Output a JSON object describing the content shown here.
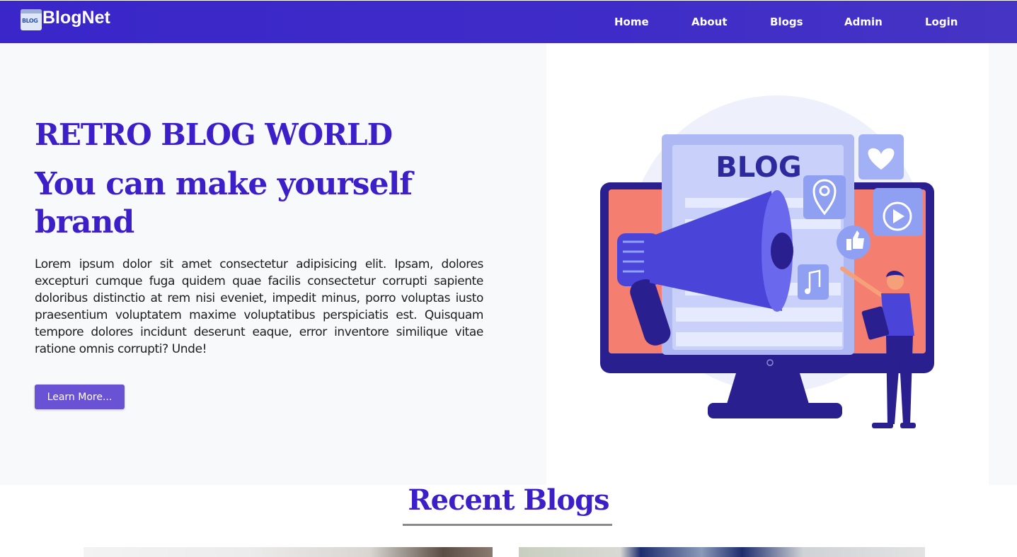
{
  "navbar": {
    "logo_text": "BLOG",
    "brand_name": "BlogNet",
    "links": [
      "Home",
      "About",
      "Blogs",
      "Admin",
      "Login"
    ]
  },
  "hero": {
    "title": "RETRO BLOG WORLD",
    "subtitle": "You can make yourself brand",
    "paragraph": "Lorem ipsum dolor sit amet consectetur adipisicing elit. Ipsam, dolores excepturi cumque fuga quidem quae facilis consectetur corrupti sapiente doloribus distinctio at rem nisi eveniet, impedit minus, porro voluptas iusto praesentium voluptatem maxime voluptatibus perspiciatis est. Quisquam tempore dolores incidunt deserunt eaque, error inventore similique vitae ratione omnis corrupti? Unde!",
    "button_label": "Learn More...",
    "illustration_text": "BLOG"
  },
  "recent": {
    "title": "Recent Blogs"
  },
  "colors": {
    "navbar": "#3a26c9",
    "heading": "#3d1fc9",
    "button": "#6a52d4"
  }
}
